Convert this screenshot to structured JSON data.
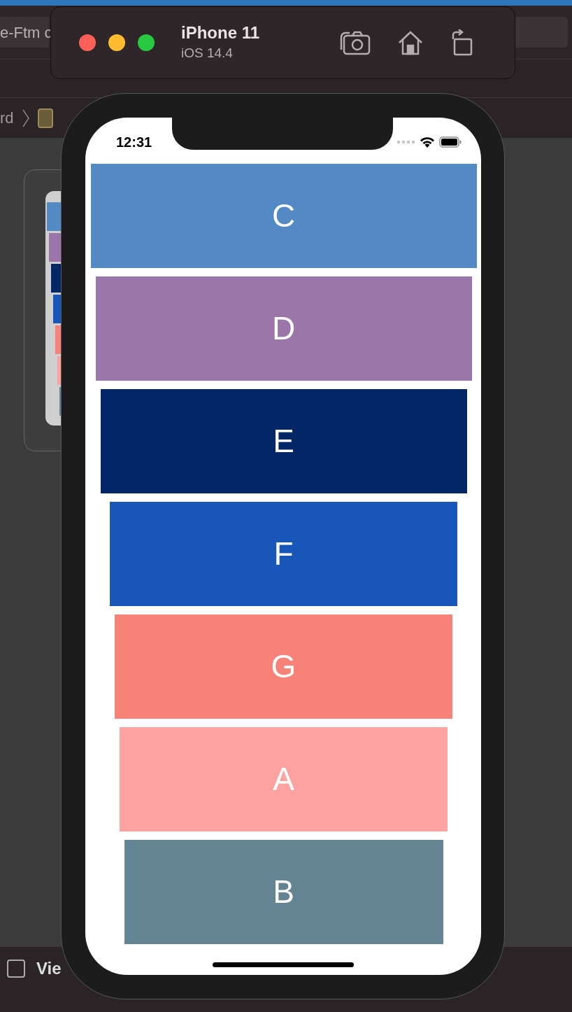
{
  "xcode": {
    "toolbar_field": "e-Ftm c",
    "breadcrumb": [
      "rd"
    ],
    "bottom_label": "Vie"
  },
  "simulator": {
    "device": "iPhone 11",
    "os": "iOS 14.4"
  },
  "status_bar": {
    "time": "12:31"
  },
  "cells": [
    {
      "label": "C",
      "color": "#548ac4"
    },
    {
      "label": "D",
      "color": "#9b76a9"
    },
    {
      "label": "E",
      "color": "#032766"
    },
    {
      "label": "F",
      "color": "#1856b8"
    },
    {
      "label": "G",
      "color": "#f78378"
    },
    {
      "label": "A",
      "color": "#fca2a1"
    },
    {
      "label": "B",
      "color": "#648393"
    }
  ]
}
